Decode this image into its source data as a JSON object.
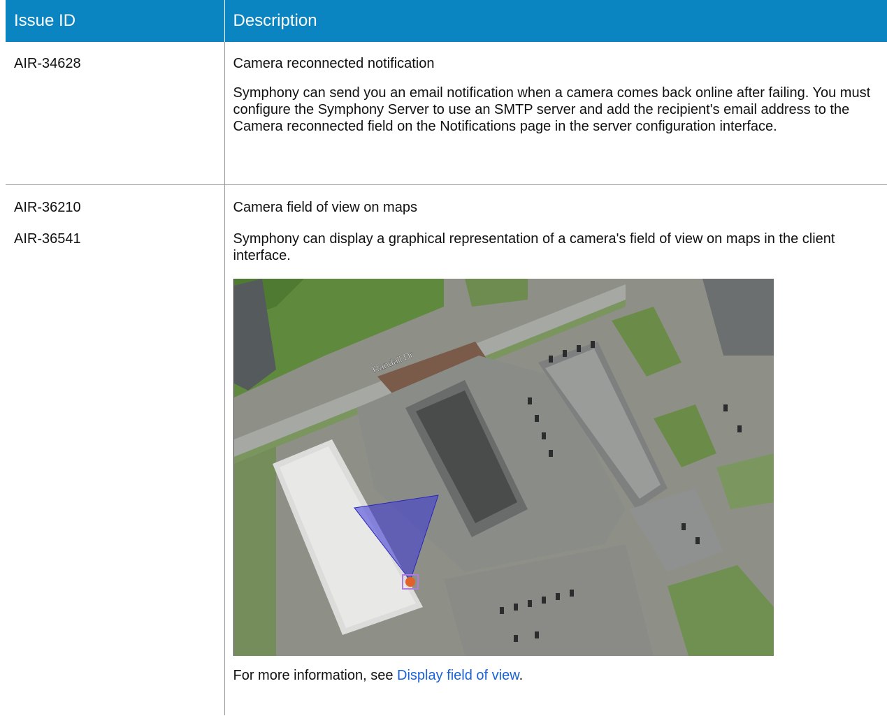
{
  "table": {
    "headers": {
      "id": "Issue ID",
      "description": "Description"
    },
    "rows": [
      {
        "ids": [
          "AIR-34628"
        ],
        "title": "Camera reconnected notification",
        "body": "Symphony can send you an email notification when a camera comes back online after failing. You must configure the Symphony Server to use an SMTP server and add the recipient's email address to the Camera reconnected field on the Notifications page in the server configuration interface."
      },
      {
        "ids": [
          "AIR-36210",
          "AIR-36541"
        ],
        "title": "Camera field of view on maps",
        "body": "Symphony can display a graphical representation of a camera's field of view on maps in the client interface.",
        "map": {
          "street_label": "Randall Dr"
        },
        "more_info": {
          "prefix": "For more information, see ",
          "link": "Display field of view",
          "suffix": "."
        }
      }
    ]
  },
  "colors": {
    "header_bg": "#0a85c2",
    "link": "#1a62d6",
    "fov_fill": "#3a36d8",
    "camera": "#e0622a"
  }
}
